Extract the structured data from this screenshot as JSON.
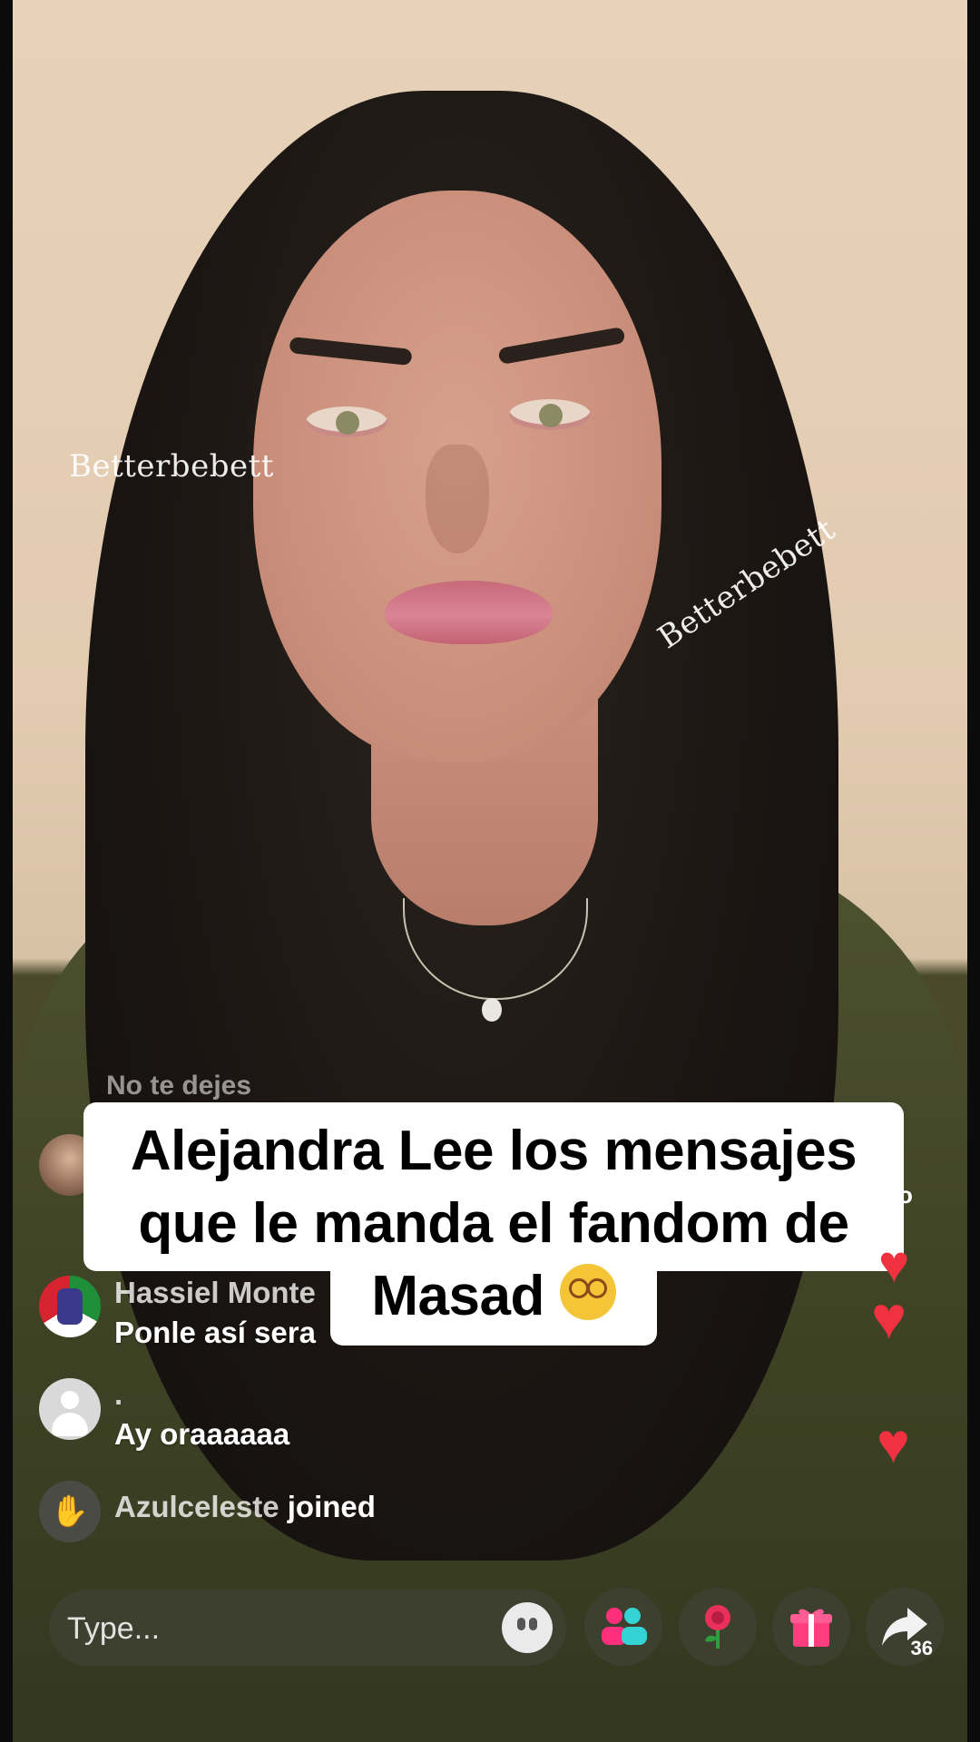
{
  "watermarks": [
    "Betterbebett",
    "Betterbebett"
  ],
  "caption": {
    "line1": "Alejandra Lee los mensajes",
    "line2": "que le manda el fandom de",
    "line3": "Masad"
  },
  "comments": {
    "ghost": "No te dejes",
    "items": [
      {
        "name": "Hassiel Monte",
        "text": "Ponle así sera"
      },
      {
        "name": ".",
        "text": "Ay oraaaaaa"
      }
    ],
    "joined": {
      "user": "Azulceleste",
      "action": "joined"
    }
  },
  "side_fragment": "o",
  "input": {
    "placeholder": "Type..."
  },
  "share_count": "36",
  "colors": {
    "heart": "#f0313f",
    "sweater": "#4d5230",
    "caption_bg": "#ffffff"
  },
  "icons": [
    "emoji-icon",
    "guests-icon",
    "rose-gift-icon",
    "gift-icon",
    "share-icon",
    "wave-icon",
    "heart-icon"
  ]
}
